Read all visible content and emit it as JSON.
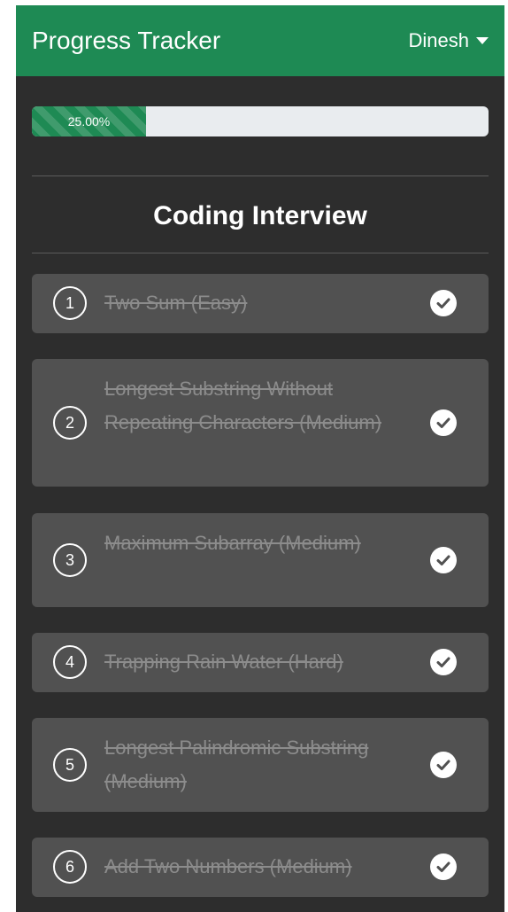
{
  "navbar": {
    "brand": "Progress Tracker",
    "user_name": "Dinesh",
    "bg_color": "#1e8a54"
  },
  "progress": {
    "label": "25.00%",
    "percent": 25
  },
  "section": {
    "title": "Coding Interview"
  },
  "questions": [
    {
      "number": "1",
      "title": "Two Sum (Easy)",
      "completed": true,
      "icon": "check-circle-icon"
    },
    {
      "number": "2",
      "title": "Longest Substring Without Repeating Characters (Medium)",
      "completed": true,
      "icon": "check-circle-icon"
    },
    {
      "number": "3",
      "title": "Maximum Subarray (Medium)",
      "completed": true,
      "icon": "check-circle-icon"
    },
    {
      "number": "4",
      "title": "Trapping Rain Water (Hard)",
      "completed": true,
      "icon": "check-circle-icon"
    },
    {
      "number": "5",
      "title": "Longest Palindromic Substring (Medium)",
      "completed": true,
      "icon": "check-circle-icon"
    },
    {
      "number": "6",
      "title": "Add Two Numbers (Medium)",
      "completed": true,
      "icon": "check-circle-icon"
    }
  ]
}
